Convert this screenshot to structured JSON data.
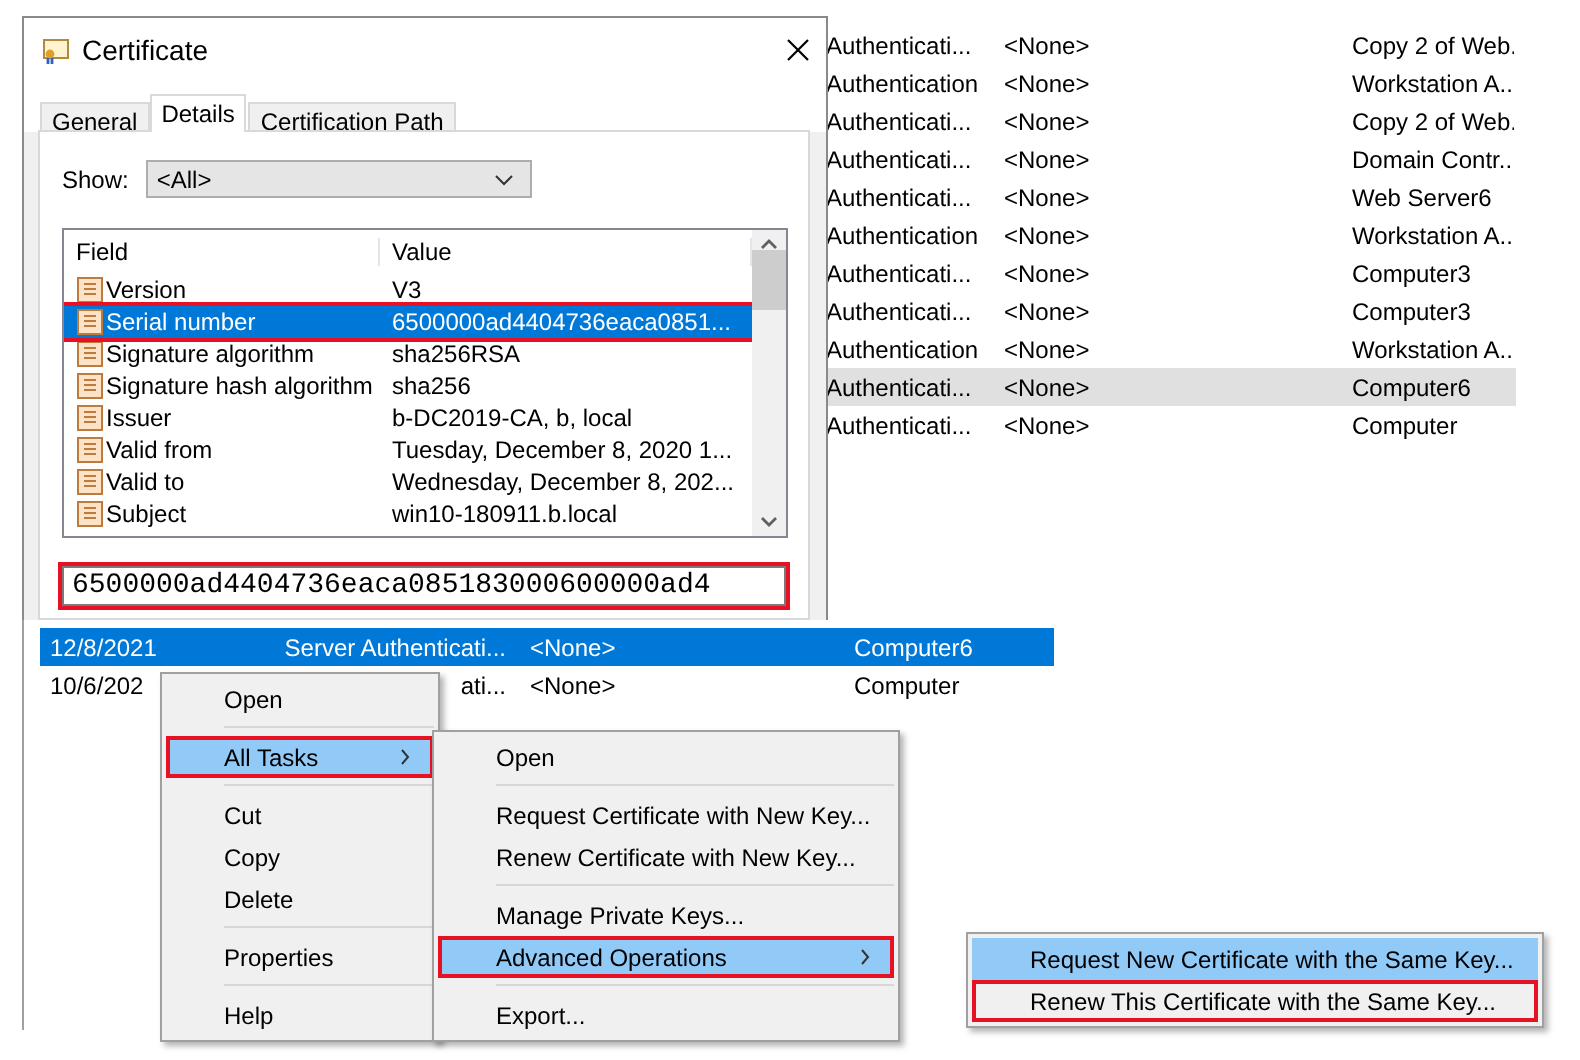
{
  "background_list": {
    "rows": [
      {
        "column_1": "Authenticati...",
        "column_2": "<None>",
        "column_3": "Copy 2 of Web.",
        "selected": false
      },
      {
        "column_1": "Authentication",
        "column_2": "<None>",
        "column_3": "Workstation A..",
        "selected": false
      },
      {
        "column_1": "Authenticati...",
        "column_2": "<None>",
        "column_3": "Copy 2 of Web.",
        "selected": false
      },
      {
        "column_1": "Authenticati...",
        "column_2": "<None>",
        "column_3": "Domain Contr..",
        "selected": false
      },
      {
        "column_1": "Authenticati...",
        "column_2": "<None>",
        "column_3": "Web Server6",
        "selected": false
      },
      {
        "column_1": "Authentication",
        "column_2": "<None>",
        "column_3": "Workstation A..",
        "selected": false
      },
      {
        "column_1": "Authenticati...",
        "column_2": "<None>",
        "column_3": "Computer3",
        "selected": false
      },
      {
        "column_1": "Authenticati...",
        "column_2": "<None>",
        "column_3": "Computer3",
        "selected": false
      },
      {
        "column_1": "Authentication",
        "column_2": "<None>",
        "column_3": "Workstation A..",
        "selected": false
      },
      {
        "column_1": "Authenticati...",
        "column_2": "<None>",
        "column_3": "Computer6",
        "selected": true
      },
      {
        "column_1": "Authenticati...",
        "column_2": "<None>",
        "column_3": "Computer",
        "selected": false
      }
    ]
  },
  "certificate_dialog": {
    "title": "Certificate",
    "tabs": [
      {
        "label": "General",
        "selected": false
      },
      {
        "label": "Details",
        "selected": true
      },
      {
        "label": "Certification Path",
        "selected": false
      }
    ],
    "show_label": "Show:",
    "show_value": "<All>",
    "columns": [
      "Field",
      "Value"
    ],
    "fields": [
      {
        "field": "Version",
        "value": "V3",
        "selected": false,
        "annotated": false
      },
      {
        "field": "Serial number",
        "value": "6500000ad4404736eaca0851...",
        "selected": true,
        "annotated": true
      },
      {
        "field": "Signature algorithm",
        "value": "sha256RSA",
        "selected": false,
        "annotated": false
      },
      {
        "field": "Signature hash algorithm",
        "value": "sha256",
        "selected": false,
        "annotated": false
      },
      {
        "field": "Issuer",
        "value": "b-DC2019-CA, b, local",
        "selected": false,
        "annotated": false
      },
      {
        "field": "Valid from",
        "value": "Tuesday, December 8, 2020 1...",
        "selected": false,
        "annotated": false
      },
      {
        "field": "Valid to",
        "value": "Wednesday, December 8, 202...",
        "selected": false,
        "annotated": false
      },
      {
        "field": "Subject",
        "value": "win10-180911.b.local",
        "selected": false,
        "annotated": false
      }
    ],
    "detail_value": "6500000ad4404736eaca085183000600000ad4",
    "detail_annotated": true
  },
  "certificate_list": {
    "rows": [
      {
        "cells": [
          "12/8/2021",
          "Server Authenticati...",
          "<None>",
          "Computer6"
        ],
        "selected": true
      },
      {
        "cells": [
          "10/6/202",
          "ati...",
          "<None>",
          "Computer"
        ],
        "selected": false
      }
    ]
  },
  "context_menu": {
    "items": [
      {
        "kind": "item",
        "label": "Open",
        "selected": false,
        "annotated": false,
        "has_submenu": false
      },
      {
        "kind": "separator"
      },
      {
        "kind": "item",
        "label": "All Tasks",
        "selected": true,
        "annotated": true,
        "has_submenu": true
      },
      {
        "kind": "separator"
      },
      {
        "kind": "item",
        "label": "Cut",
        "selected": false,
        "annotated": false,
        "has_submenu": false
      },
      {
        "kind": "item",
        "label": "Copy",
        "selected": false,
        "annotated": false,
        "has_submenu": false
      },
      {
        "kind": "item",
        "label": "Delete",
        "selected": false,
        "annotated": false,
        "has_submenu": false
      },
      {
        "kind": "separator"
      },
      {
        "kind": "item",
        "label": "Properties",
        "selected": false,
        "annotated": false,
        "has_submenu": false
      },
      {
        "kind": "separator"
      },
      {
        "kind": "item",
        "label": "Help",
        "selected": false,
        "annotated": false,
        "has_submenu": false
      }
    ]
  },
  "all_tasks_menu": {
    "items": [
      {
        "kind": "item",
        "label": "Open",
        "selected": false,
        "annotated": false,
        "has_submenu": false
      },
      {
        "kind": "separator"
      },
      {
        "kind": "item",
        "label": "Request Certificate with New Key...",
        "selected": false,
        "annotated": false,
        "has_submenu": false
      },
      {
        "kind": "item",
        "label": "Renew Certificate with New Key...",
        "selected": false,
        "annotated": false,
        "has_submenu": false
      },
      {
        "kind": "separator"
      },
      {
        "kind": "item",
        "label": "Manage Private Keys...",
        "selected": false,
        "annotated": false,
        "has_submenu": false
      },
      {
        "kind": "item",
        "label": "Advanced Operations",
        "selected": true,
        "annotated": true,
        "has_submenu": true
      },
      {
        "kind": "separator"
      },
      {
        "kind": "item",
        "label": "Export...",
        "selected": false,
        "annotated": false,
        "has_submenu": false
      }
    ]
  },
  "advanced_menu": {
    "items": [
      {
        "kind": "item",
        "label": "Request New Certificate with the Same Key...",
        "selected": true,
        "annotated": false,
        "has_submenu": false
      },
      {
        "kind": "item",
        "label": "Renew This Certificate with the Same Key...",
        "selected": false,
        "annotated": true,
        "has_submenu": false
      }
    ]
  }
}
